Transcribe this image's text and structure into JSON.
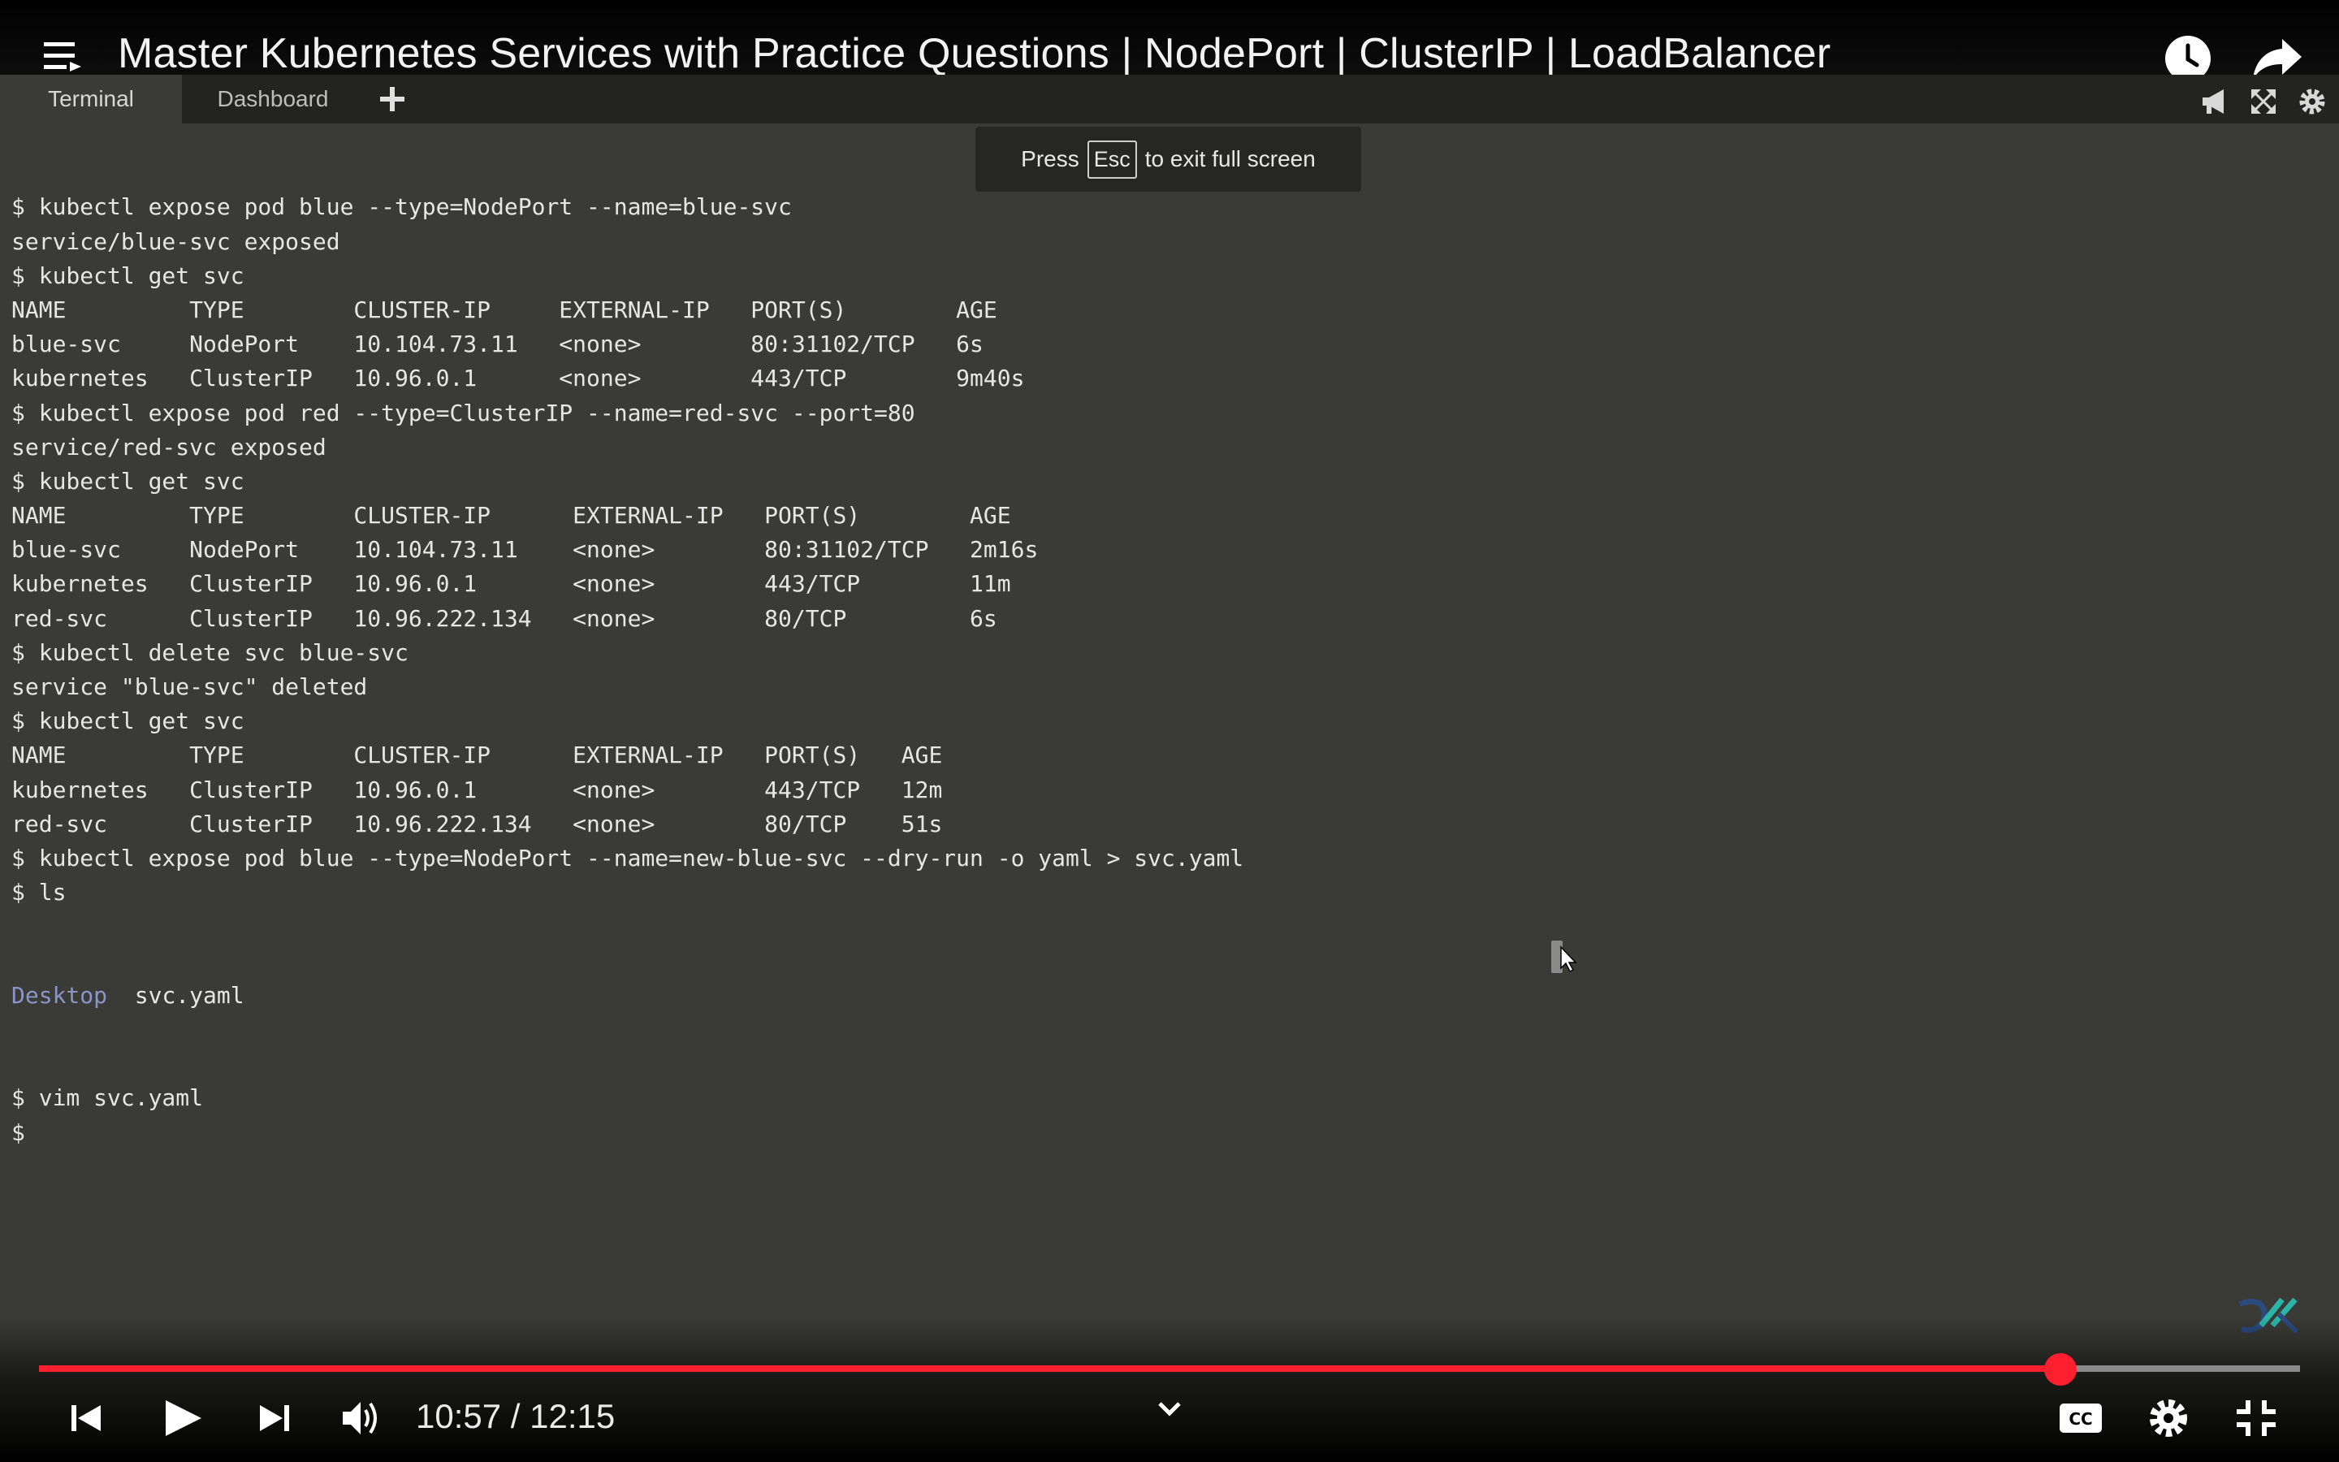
{
  "video": {
    "title": "Master Kubernetes Services with Practice Questions | NodePort | ClusterIP | LoadBalancer",
    "current_time": "10:57",
    "duration": "12:15",
    "time_display": "10:57 / 12:15",
    "progress": 0.8939
  },
  "tabs": [
    {
      "label": "Terminal",
      "active": true
    },
    {
      "label": "Dashboard",
      "active": false
    }
  ],
  "toast": {
    "prefix": "Press",
    "key": "Esc",
    "suffix": "to exit full screen"
  },
  "terminal": {
    "lines": [
      "$ kubectl expose pod blue --type=NodePort --name=blue-svc",
      "service/blue-svc exposed",
      "$ kubectl get svc",
      "NAME         TYPE        CLUSTER-IP     EXTERNAL-IP   PORT(S)        AGE",
      "blue-svc     NodePort    10.104.73.11   <none>        80:31102/TCP   6s",
      "kubernetes   ClusterIP   10.96.0.1      <none>        443/TCP        9m40s",
      "$ kubectl expose pod red --type=ClusterIP --name=red-svc --port=80",
      "service/red-svc exposed",
      "$ kubectl get svc",
      "NAME         TYPE        CLUSTER-IP      EXTERNAL-IP   PORT(S)        AGE",
      "blue-svc     NodePort    10.104.73.11    <none>        80:31102/TCP   2m16s",
      "kubernetes   ClusterIP   10.96.0.1       <none>        443/TCP        11m",
      "red-svc      ClusterIP   10.96.222.134   <none>        80/TCP         6s",
      "$ kubectl delete svc blue-svc",
      "service \"blue-svc\" deleted",
      "$ kubectl get svc",
      "NAME         TYPE        CLUSTER-IP      EXTERNAL-IP   PORT(S)   AGE",
      "kubernetes   ClusterIP   10.96.0.1       <none>        443/TCP   12m",
      "red-svc      ClusterIP   10.96.222.134   <none>        80/TCP    51s",
      "$ kubectl expose pod blue --type=NodePort --name=new-blue-svc --dry-run -o yaml > svc.yaml",
      "$ ls"
    ],
    "ls_output": {
      "dir": "Desktop",
      "file": "svc.yaml"
    },
    "after_lines": [
      "$ vim svc.yaml",
      "$"
    ]
  },
  "icons": {
    "menu": "playlist-menu-icon",
    "watch_later": "clock-icon",
    "share": "share-arrow-icon",
    "add_tab": "plus-icon",
    "announce": "megaphone-icon",
    "expand": "expand-icon",
    "settings": "gear-icon",
    "prev": "skip-previous-icon",
    "play": "play-icon",
    "next": "skip-next-icon",
    "volume": "volume-icon",
    "captions": "cc-icon",
    "player_settings": "gear-icon",
    "exit_fullscreen": "exit-fullscreen-icon"
  },
  "colors": {
    "progress": "#ff1f2f",
    "terminal_bg": "#3a3a36",
    "directory": "#8a96c8"
  }
}
